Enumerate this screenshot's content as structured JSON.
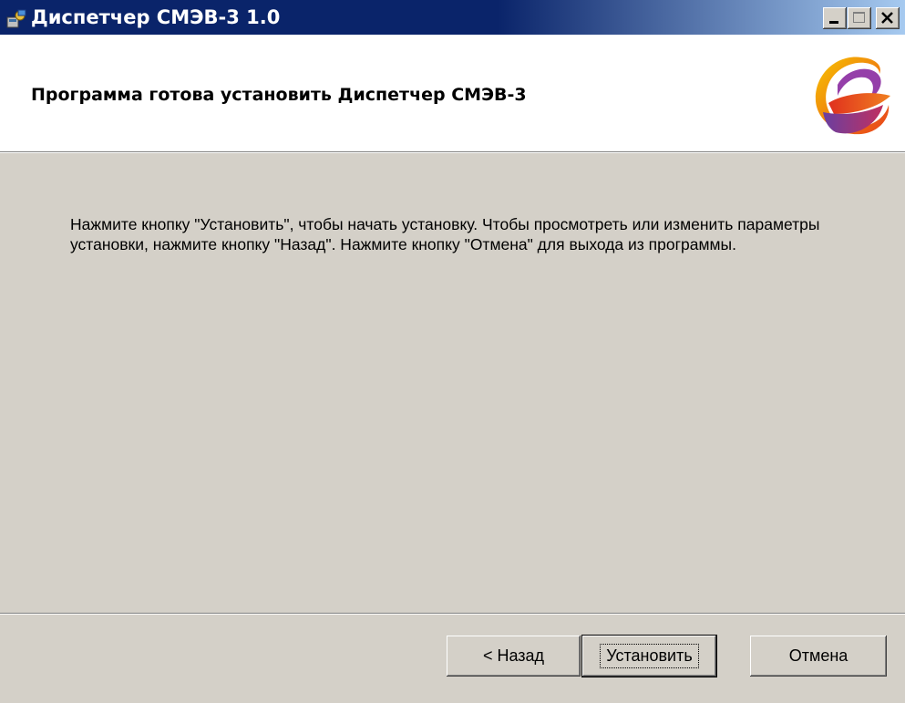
{
  "window": {
    "title": "Диспетчер СМЭВ-3 1.0",
    "header_title": "Программа готова установить Диспетчер СМЭВ-3",
    "body_text": "Нажмите кнопку \"Установить\", чтобы начать установку. Чтобы просмотреть или изменить параметры установки, нажмите кнопку \"Назад\". Нажмите кнопку \"Отмена\" для выхода из программы."
  },
  "buttons": {
    "back_label": "< Назад",
    "install_label": "Установить",
    "cancel_label": "Отмена"
  },
  "icons": {
    "app": "installer-icon",
    "logo": "smev-logo",
    "minimize": "minimize-icon",
    "maximize": "maximize-icon",
    "close": "close-icon"
  },
  "colors": {
    "titlebar_start": "#0a246a",
    "titlebar_end": "#a6caf0",
    "dialog_bg": "#d4d0c8"
  }
}
